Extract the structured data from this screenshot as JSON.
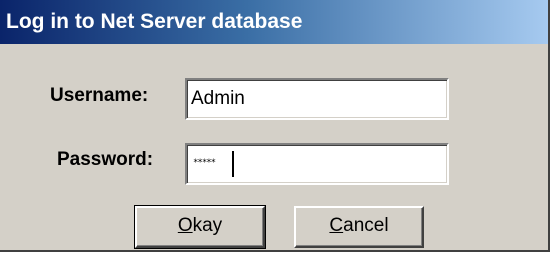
{
  "window": {
    "title": "Log in to Net Server database"
  },
  "form": {
    "username_label": "Username:",
    "username_value": "Admin",
    "password_label": "Password:",
    "password_mask": "*****"
  },
  "buttons": {
    "okay": {
      "accel": "O",
      "rest": "kay"
    },
    "cancel": {
      "accel": "C",
      "rest": "ancel"
    }
  },
  "colors": {
    "dialog_bg": "#d4d0c8",
    "titlebar_start": "#0a246a",
    "titlebar_end": "#a6caf0",
    "title_text": "#ffffff"
  }
}
